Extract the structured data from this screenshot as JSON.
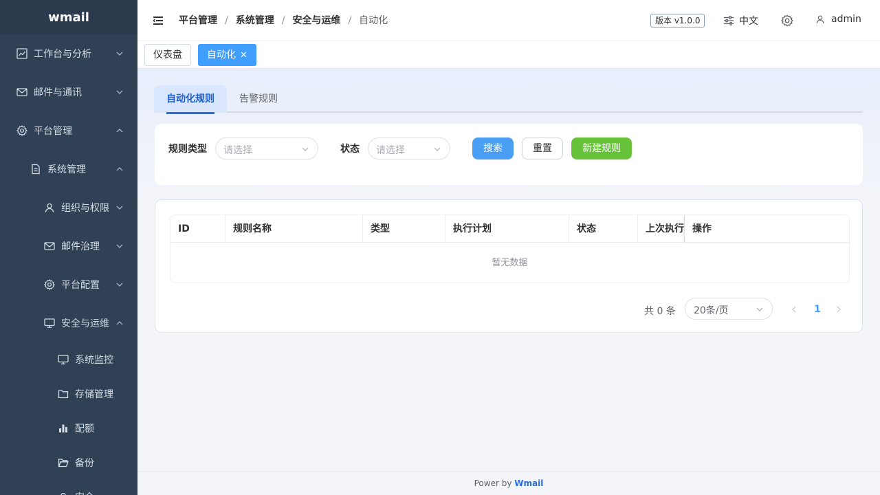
{
  "app": {
    "logo": "wmail"
  },
  "sidebar": {
    "items": [
      {
        "label": "工作台与分析",
        "icon": "trend-chart-icon"
      },
      {
        "label": "邮件与通讯",
        "icon": "mail-icon"
      },
      {
        "label": "平台管理",
        "icon": "gear-icon"
      },
      {
        "label": "系统管理",
        "icon": "document-icon"
      },
      {
        "label": "组织与权限",
        "icon": "user-icon"
      },
      {
        "label": "邮件治理",
        "icon": "mail-icon"
      },
      {
        "label": "平台配置",
        "icon": "gear-icon"
      },
      {
        "label": "安全与运维",
        "icon": "monitor-icon"
      },
      {
        "label": "系统监控",
        "icon": "monitor-icon"
      },
      {
        "label": "存储管理",
        "icon": "folder-icon"
      },
      {
        "label": "配额",
        "icon": "bar-chart-icon"
      },
      {
        "label": "备份",
        "icon": "folder-open-icon"
      },
      {
        "label": "安全",
        "icon": "user-icon"
      }
    ]
  },
  "header": {
    "breadcrumb": [
      "平台管理",
      "系统管理",
      "安全与运维",
      "自动化"
    ],
    "separator": "/",
    "version": "版本 v1.0.0",
    "language": "中文",
    "username": "admin"
  },
  "tags": {
    "dashboard": "仪表盘",
    "current": "自动化",
    "close": "✕"
  },
  "tabs": {
    "automation": "自动化规则",
    "alert": "告警规则"
  },
  "filter": {
    "rule_type_label": "规则类型",
    "rule_type_placeholder": "请选择",
    "status_label": "状态",
    "status_placeholder": "请选择",
    "search_button": "搜索",
    "reset_button": "重置",
    "new_button": "新建规则"
  },
  "table": {
    "columns": [
      "ID",
      "规则名称",
      "类型",
      "执行计划",
      "状态",
      "上次执行",
      "操作"
    ],
    "rows": [],
    "empty_text": "暂无数据"
  },
  "pagination": {
    "total": "共 0 条",
    "page_size": "20条/页",
    "current_page": "1"
  },
  "footer": {
    "prefix": "Power by",
    "brand": "Wmail"
  },
  "colors": {
    "sidebar_bg": "#304156",
    "primary": "#409eff",
    "success": "#67c23a"
  }
}
